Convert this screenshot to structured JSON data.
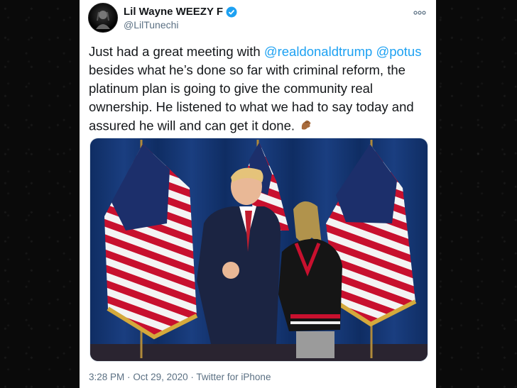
{
  "tweet": {
    "display_name": "Lil Wayne WEEZY F",
    "handle": "@LilTunechi",
    "text_before": "Just had a great meeting with ",
    "mention_1": "@realdonaldtrump",
    "mention_2": "@potus",
    "text_after": "besides what he’s done so far with criminal reform, the platinum plan is going to give the community real ownership. He listened to what we had to say today and assured he will and can get it done.",
    "emoji": "pinching-hand-emoji",
    "time": "3:28 PM",
    "date": "Oct 29, 2020",
    "source": "Twitter for iPhone",
    "separator": "·"
  },
  "icons": {
    "verified": "verified-badge-icon",
    "more": "more-options-icon"
  },
  "colors": {
    "link": "#1da1f2",
    "text": "#14171a",
    "muted": "#5b7083",
    "curtain": "#13346e"
  }
}
